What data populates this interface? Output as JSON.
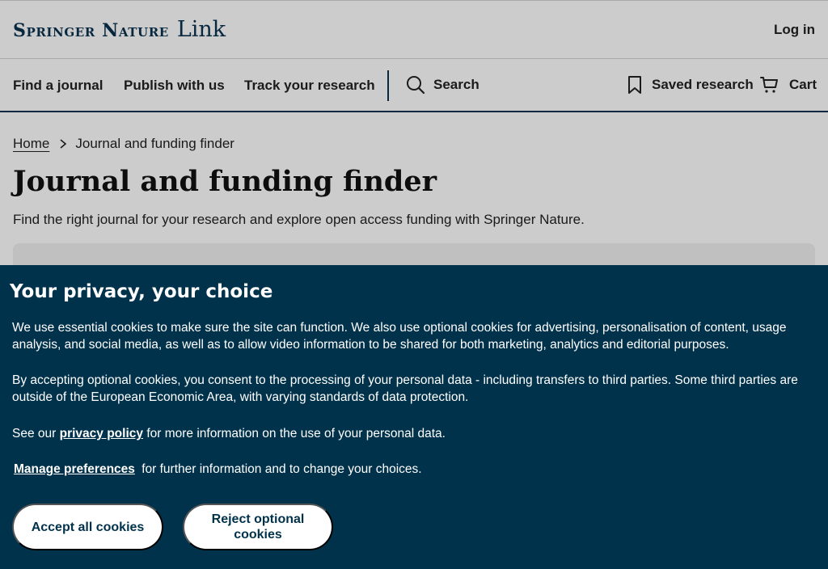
{
  "header": {
    "brand": "Springer Nature",
    "product": "Link",
    "login": "Log in"
  },
  "nav": {
    "find_journal": "Find a journal",
    "publish": "Publish with us",
    "track": "Track your research",
    "search": "Search",
    "saved": "Saved research",
    "cart": "Cart"
  },
  "breadcrumb": {
    "home": "Home",
    "current": "Journal and funding finder"
  },
  "main": {
    "title": "Journal and funding finder",
    "description": "Find the right journal for your research and explore open access funding with Springer Nature."
  },
  "cookie": {
    "title": "Your privacy, your choice",
    "p1": "We use essential cookies to make sure the site can function. We also use optional cookies for advertising, personalisation of content, usage analysis, and social media, as well as to allow video information to be shared for both marketing, analytics and editorial purposes.",
    "p2": "By accepting optional cookies, you consent to the processing of your personal data - including transfers to third parties. Some third parties are outside of the European Economic Area, with varying standards of data protection.",
    "p3_prefix": "See our",
    "privacy_link": "privacy policy",
    "p3_suffix": "for more information on the use of your personal data.",
    "manage_link": "Manage preferences",
    "manage_suffix": "for further information and to change your choices.",
    "accept": "Accept all cookies",
    "reject": "Reject optional cookies"
  },
  "colors": {
    "brand_navy": "#0b3250",
    "banner_bg": "#01324b"
  }
}
